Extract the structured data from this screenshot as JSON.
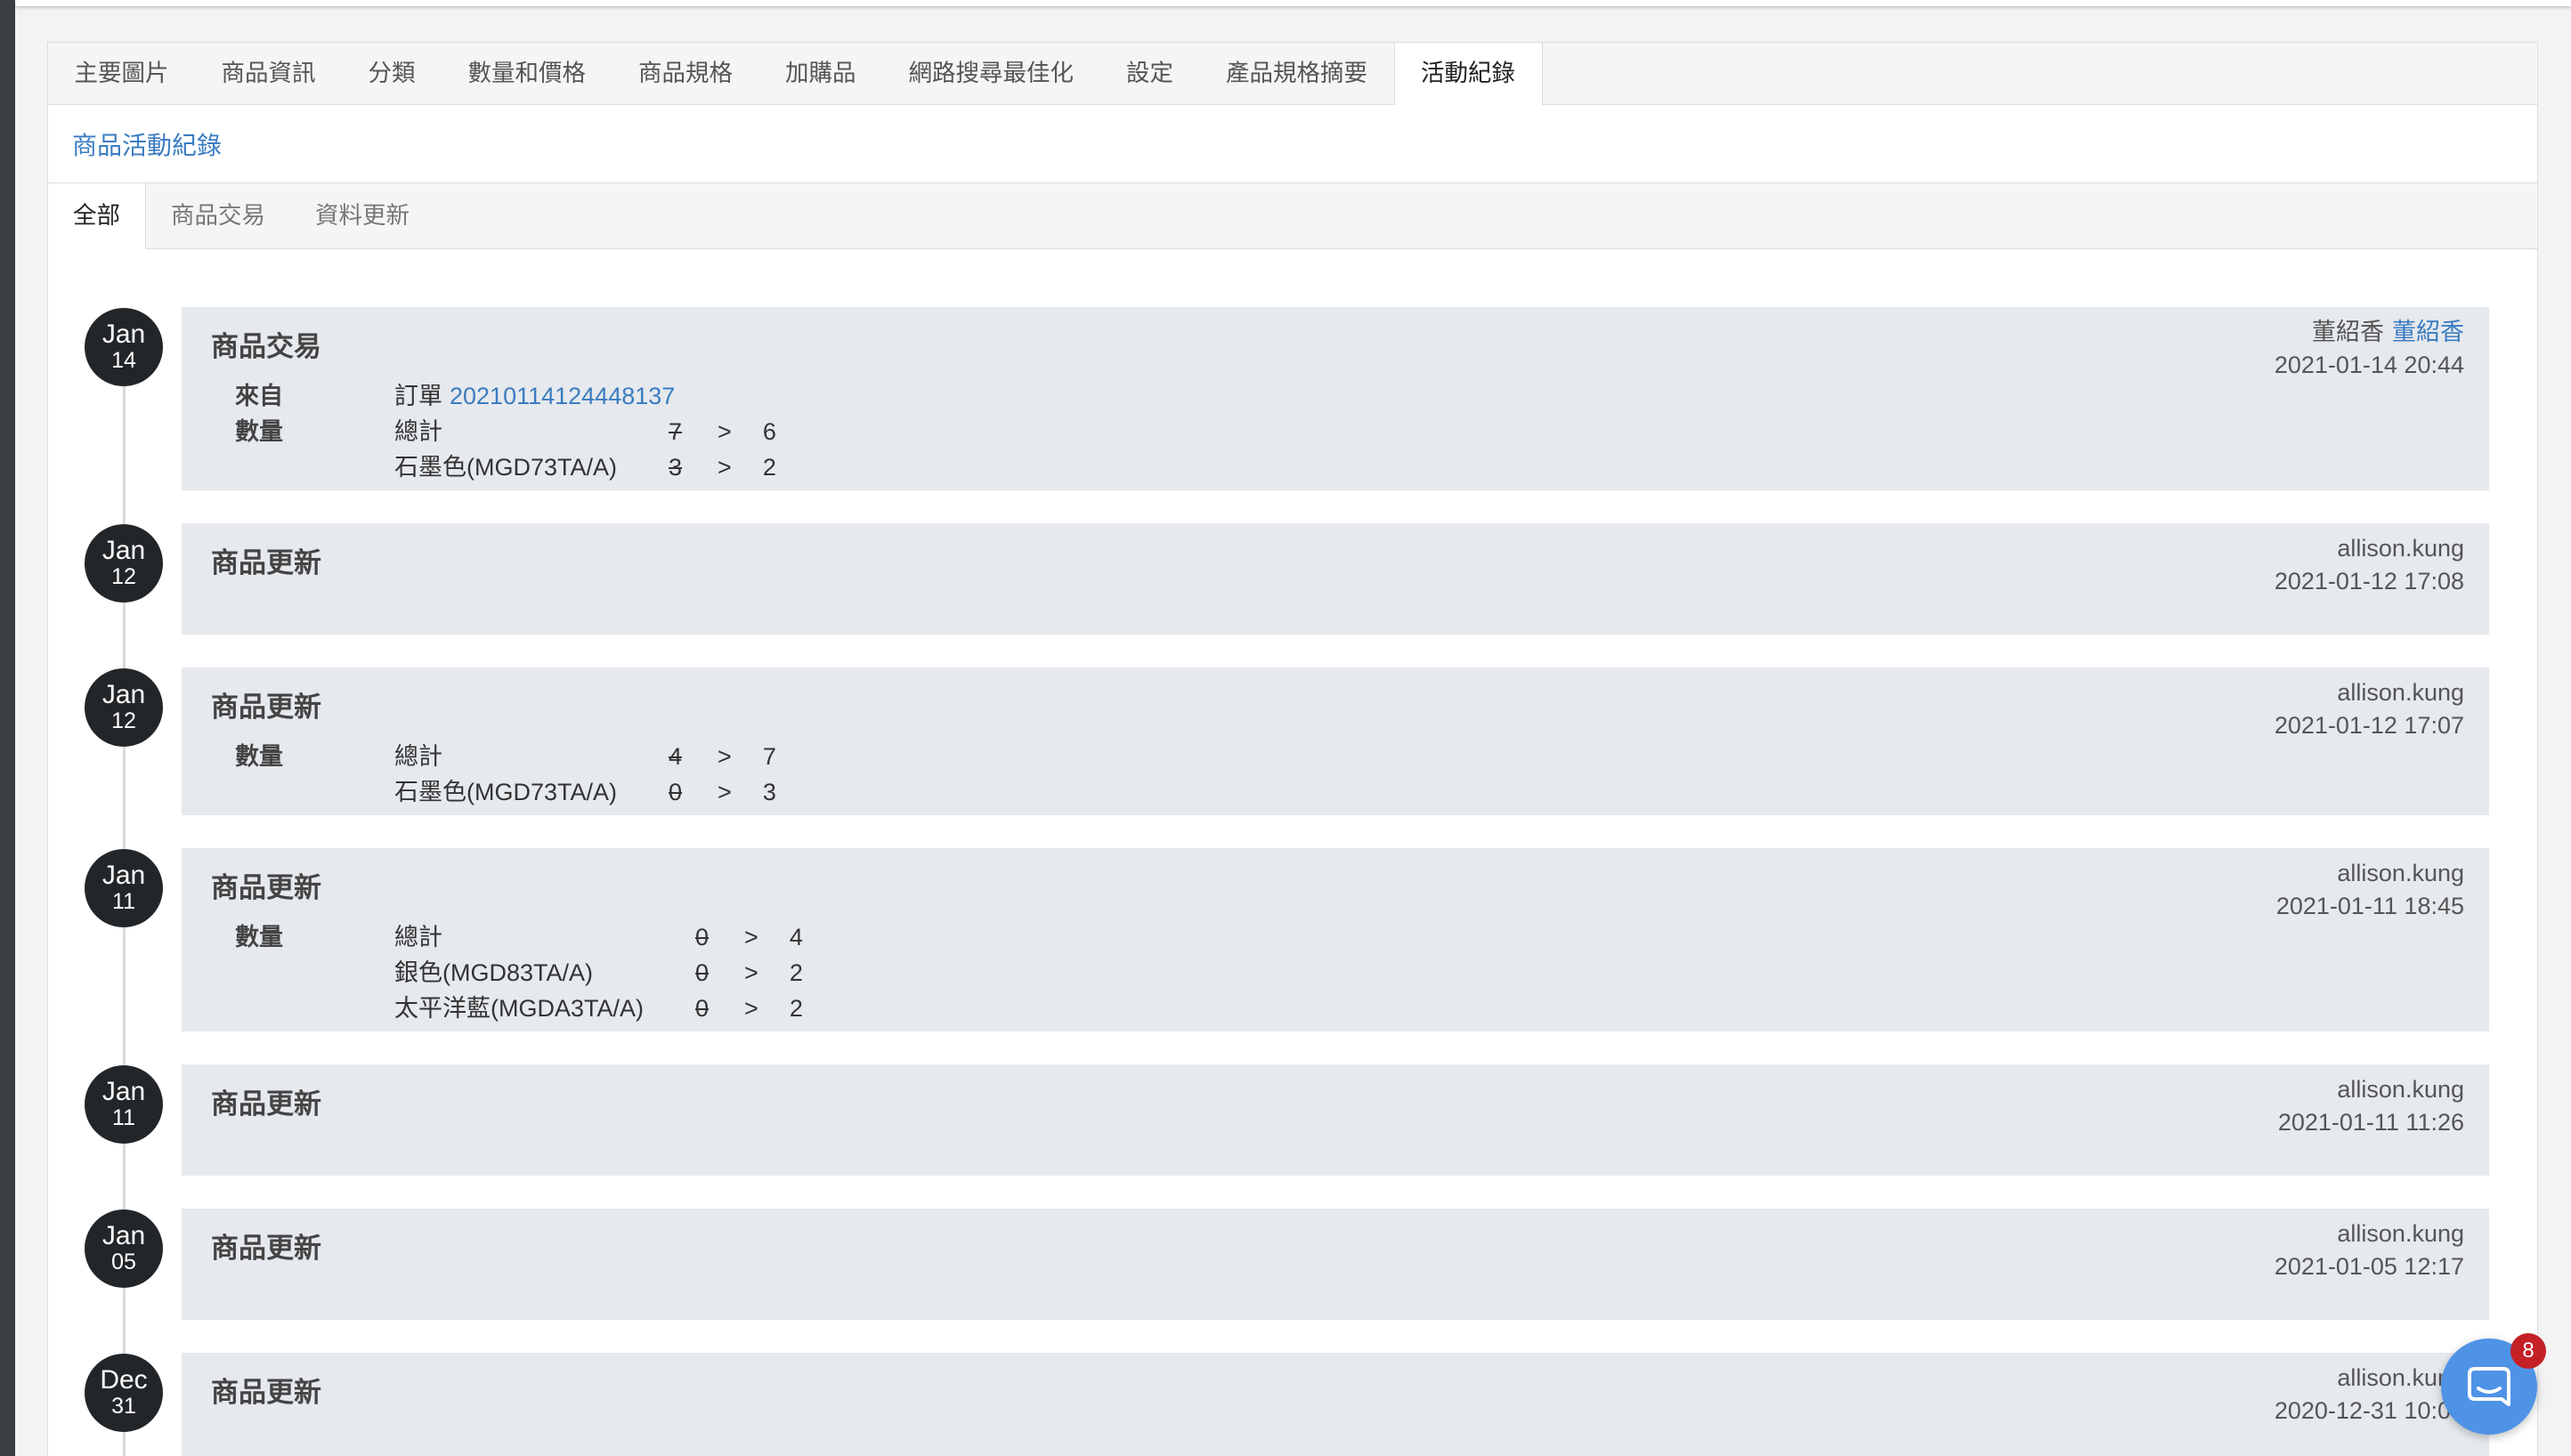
{
  "tabs": [
    {
      "label": "主要圖片"
    },
    {
      "label": "商品資訊"
    },
    {
      "label": "分類"
    },
    {
      "label": "數量和價格"
    },
    {
      "label": "商品規格"
    },
    {
      "label": "加購品"
    },
    {
      "label": "網路搜尋最佳化"
    },
    {
      "label": "設定"
    },
    {
      "label": "產品規格摘要"
    },
    {
      "label": "活動紀錄",
      "active": true
    }
  ],
  "section": {
    "title": "商品活動紀錄"
  },
  "subtabs": [
    {
      "label": "全部",
      "active": true
    },
    {
      "label": "商品交易"
    },
    {
      "label": "資料更新"
    }
  ],
  "change_arrow": ">",
  "timeline": [
    {
      "month": "Jan",
      "day": "14",
      "title": "商品交易",
      "user": "董紹香",
      "user_link": "董紹香",
      "time": "2021-01-14 20:44",
      "source": {
        "label": "來自",
        "prefix": "訂單",
        "order_no": "20210114124448137"
      },
      "quantity": {
        "label": "數量",
        "rows": [
          {
            "name": "總計",
            "old": "7",
            "new": "6"
          },
          {
            "name": "石墨色(MGD73TA/A)",
            "old": "3",
            "new": "2"
          }
        ]
      }
    },
    {
      "month": "Jan",
      "day": "12",
      "title": "商品更新",
      "user": "allison.kung",
      "time": "2021-01-12 17:08"
    },
    {
      "month": "Jan",
      "day": "12",
      "title": "商品更新",
      "user": "allison.kung",
      "time": "2021-01-12 17:07",
      "quantity": {
        "label": "數量",
        "rows": [
          {
            "name": "總計",
            "old": "4",
            "new": "7"
          },
          {
            "name": "石墨色(MGD73TA/A)",
            "old": "0",
            "new": "3"
          }
        ]
      }
    },
    {
      "month": "Jan",
      "day": "11",
      "title": "商品更新",
      "user": "allison.kung",
      "time": "2021-01-11 18:45",
      "quantity": {
        "label": "數量",
        "rows": [
          {
            "name": "總計",
            "old": "0",
            "new": "4"
          },
          {
            "name": "銀色(MGD83TA/A)",
            "old": "0",
            "new": "2"
          },
          {
            "name": "太平洋藍(MGDA3TA/A)",
            "old": "0",
            "new": "2"
          }
        ]
      }
    },
    {
      "month": "Jan",
      "day": "11",
      "title": "商品更新",
      "user": "allison.kung",
      "time": "2021-01-11 11:26"
    },
    {
      "month": "Jan",
      "day": "05",
      "title": "商品更新",
      "user": "allison.kung",
      "time": "2021-01-05 12:17"
    },
    {
      "month": "Dec",
      "day": "31",
      "title": "商品更新",
      "user": "allison.kung",
      "time": "2020-12-31 10:0"
    }
  ],
  "chat": {
    "icon": "chat-bubble-icon",
    "badge": "8"
  },
  "colors": {
    "accent_link": "#3a7cc1",
    "card_bg": "#e6e9ed",
    "date_badge_bg": "#232629",
    "chat_button": "#4f93e6",
    "badge_red": "#c42127",
    "sidebar_edge": "#3b3e43"
  }
}
